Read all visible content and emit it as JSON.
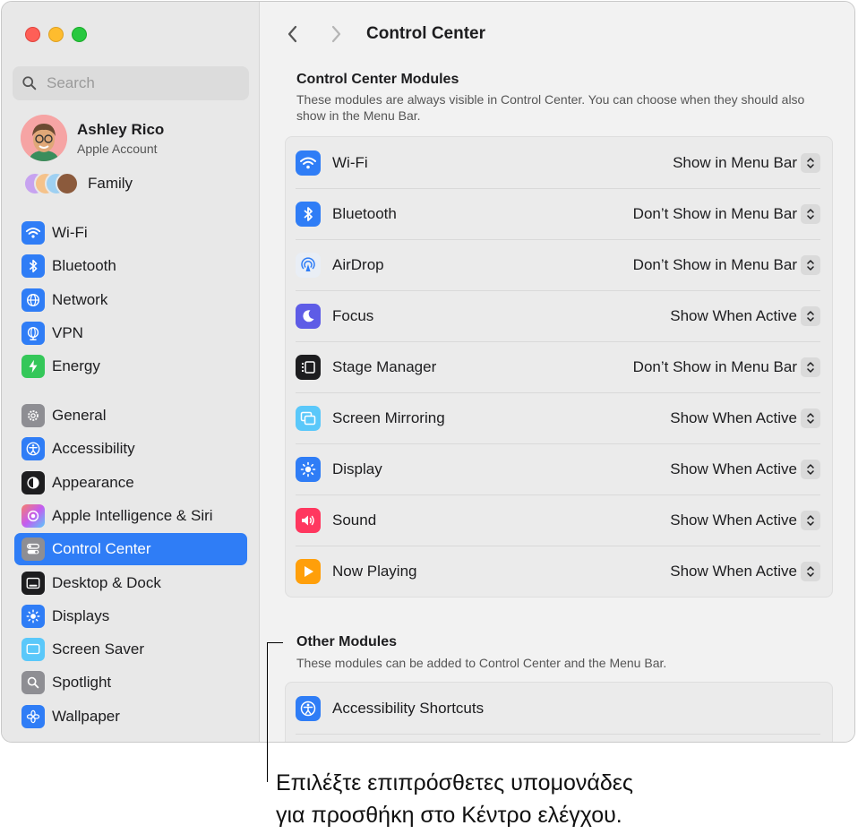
{
  "window": {
    "search_placeholder": "Search",
    "account": {
      "name": "Ashley Rico",
      "subtitle": "Apple Account"
    },
    "family_label": "Family",
    "sidebar_group1": [
      {
        "label": "Wi-Fi",
        "icon": "wifi-icon",
        "color": "#2f7df6"
      },
      {
        "label": "Bluetooth",
        "icon": "bluetooth-icon",
        "color": "#2f7df6"
      },
      {
        "label": "Network",
        "icon": "globe-icon",
        "color": "#2f7df6"
      },
      {
        "label": "VPN",
        "icon": "vpn-globe-icon",
        "color": "#2f7df6"
      },
      {
        "label": "Energy",
        "icon": "bolt-icon",
        "color": "#34c759"
      }
    ],
    "sidebar_group2": [
      {
        "label": "General",
        "icon": "gear-icon",
        "color": "#8e8e93"
      },
      {
        "label": "Accessibility",
        "icon": "accessibility-icon",
        "color": "#2f7df6"
      },
      {
        "label": "Appearance",
        "icon": "appearance-icon",
        "color": "#1d1d1f"
      },
      {
        "label": "Apple Intelligence & Siri",
        "icon": "siri-icon",
        "color": "#c45cf0"
      },
      {
        "label": "Control Center",
        "icon": "toggles-icon",
        "color": "#8e8e93",
        "selected": true
      },
      {
        "label": "Desktop & Dock",
        "icon": "dock-icon",
        "color": "#1d1d1f"
      },
      {
        "label": "Displays",
        "icon": "sun-icon",
        "color": "#2f7df6"
      },
      {
        "label": "Screen Saver",
        "icon": "screensaver-icon",
        "color": "#5ac8fa"
      },
      {
        "label": "Spotlight",
        "icon": "magnifier-icon",
        "color": "#8e8e93"
      },
      {
        "label": "Wallpaper",
        "icon": "flower-icon",
        "color": "#2f7df6"
      }
    ]
  },
  "main": {
    "title": "Control Center",
    "modules_title": "Control Center Modules",
    "modules_desc": "These modules are always visible in Control Center. You can choose when they should also show in the Menu Bar.",
    "modules": [
      {
        "label": "Wi-Fi",
        "value": "Show in Menu Bar",
        "icon": "wifi-icon",
        "color": "#2f7df6"
      },
      {
        "label": "Bluetooth",
        "value": "Don’t Show in Menu Bar",
        "icon": "bluetooth-icon",
        "color": "#2f7df6"
      },
      {
        "label": "AirDrop",
        "value": "Don’t Show in Menu Bar",
        "icon": "airdrop-icon",
        "color": "#e9eef5"
      },
      {
        "label": "Focus",
        "value": "Show When Active",
        "icon": "moon-icon",
        "color": "#5e5ce6"
      },
      {
        "label": "Stage Manager",
        "value": "Don’t Show in Menu Bar",
        "icon": "stage-manager-icon",
        "color": "#1d1d1f"
      },
      {
        "label": "Screen Mirroring",
        "value": "Show When Active",
        "icon": "screen-mirroring-icon",
        "color": "#5ac8fa"
      },
      {
        "label": "Display",
        "value": "Show When Active",
        "icon": "sun-icon",
        "color": "#2f7df6"
      },
      {
        "label": "Sound",
        "value": "Show When Active",
        "icon": "speaker-icon",
        "color": "#ff375f"
      },
      {
        "label": "Now Playing",
        "value": "Show When Active",
        "icon": "play-icon",
        "color": "#ff9f0a"
      }
    ],
    "other_title": "Other Modules",
    "other_desc": "These modules can be added to Control Center and the Menu Bar.",
    "other_modules": [
      {
        "label": "Accessibility Shortcuts",
        "icon": "accessibility-icon",
        "color": "#2f7df6"
      }
    ]
  },
  "callout": {
    "line1": "Επιλέξτε επιπρόσθετες υπομονάδες",
    "line2": "για προσθήκη στο Κέντρο ελέγχου."
  }
}
